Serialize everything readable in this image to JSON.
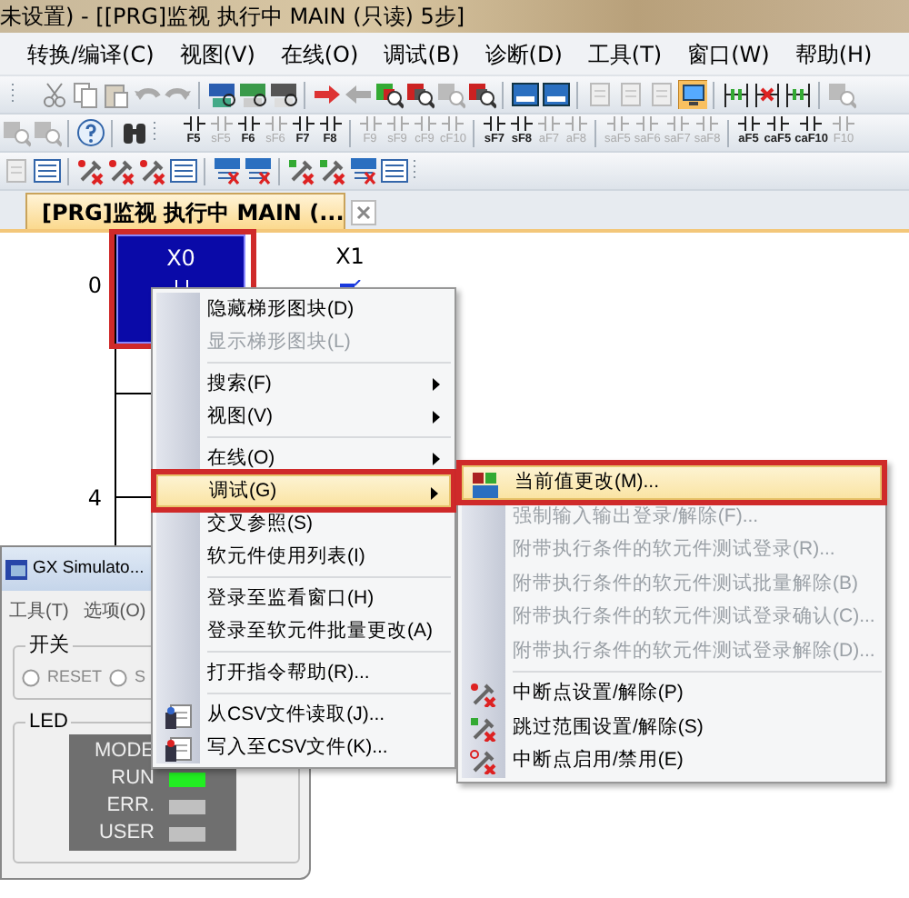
{
  "title_bar": {
    "title": "未设置) - [[PRG]监视 执行中 MAIN (只读) 5步]"
  },
  "menu_bar": [
    {
      "label": "转换/编译(C)"
    },
    {
      "label": "视图(V)"
    },
    {
      "label": "在线(O)"
    },
    {
      "label": "调试(B)"
    },
    {
      "label": "诊断(D)"
    },
    {
      "label": "工具(T)"
    },
    {
      "label": "窗口(W)"
    },
    {
      "label": "帮助(H)"
    }
  ],
  "toolbar_keys": [
    {
      "label": "F5",
      "disabled": false
    },
    {
      "label": "sF5",
      "disabled": true
    },
    {
      "label": "F6",
      "disabled": false
    },
    {
      "label": "sF6",
      "disabled": true
    },
    {
      "label": "F7",
      "disabled": false
    },
    {
      "label": "F8",
      "disabled": false
    },
    {
      "label": "F9",
      "disabled": true
    },
    {
      "label": "sF9",
      "disabled": true
    },
    {
      "label": "cF9",
      "disabled": true
    },
    {
      "label": "cF10",
      "disabled": true
    },
    {
      "label": "sF7",
      "disabled": false
    },
    {
      "label": "sF8",
      "disabled": false
    },
    {
      "label": "aF7",
      "disabled": true
    },
    {
      "label": "aF8",
      "disabled": true
    },
    {
      "label": "saF5",
      "disabled": true
    },
    {
      "label": "saF6",
      "disabled": true
    },
    {
      "label": "saF7",
      "disabled": true
    },
    {
      "label": "saF8",
      "disabled": true
    },
    {
      "label": "aF5",
      "disabled": false
    },
    {
      "label": "caF5",
      "disabled": false
    },
    {
      "label": "caF10",
      "disabled": false
    },
    {
      "label": "F10",
      "disabled": true
    }
  ],
  "tab": {
    "label": "[PRG]监视 执行中 MAIN (...",
    "selected": true
  },
  "ladder": {
    "steps": [
      {
        "label": "0"
      },
      {
        "label": "4"
      }
    ],
    "contacts": [
      {
        "label": "X0",
        "selected": true,
        "framed": true
      },
      {
        "label": "X1",
        "selected": false,
        "framed": false
      }
    ]
  },
  "context_menu": {
    "items": [
      {
        "kind": "item",
        "label": "隐藏梯形图块(D)",
        "disabled": false,
        "submenu": false,
        "selected": false,
        "framed": false,
        "has_icon": false
      },
      {
        "kind": "item",
        "label": "显示梯形图块(L)",
        "disabled": true,
        "submenu": false,
        "selected": false,
        "framed": false,
        "has_icon": false
      },
      {
        "kind": "separator"
      },
      {
        "kind": "item",
        "label": "搜索(F)",
        "disabled": false,
        "submenu": true,
        "selected": false,
        "framed": false,
        "has_icon": false
      },
      {
        "kind": "item",
        "label": "视图(V)",
        "disabled": false,
        "submenu": true,
        "selected": false,
        "framed": false,
        "has_icon": false
      },
      {
        "kind": "separator"
      },
      {
        "kind": "item",
        "label": "在线(O)",
        "disabled": false,
        "submenu": true,
        "selected": false,
        "framed": false,
        "has_icon": false
      },
      {
        "kind": "item",
        "label": "调试(G)",
        "disabled": false,
        "submenu": true,
        "selected": true,
        "framed": true,
        "has_icon": false
      },
      {
        "kind": "item",
        "label": "交叉参照(S)",
        "disabled": false,
        "submenu": false,
        "selected": false,
        "framed": false,
        "has_icon": false
      },
      {
        "kind": "item",
        "label": "软元件使用列表(I)",
        "disabled": false,
        "submenu": false,
        "selected": false,
        "framed": false,
        "has_icon": false
      },
      {
        "kind": "separator"
      },
      {
        "kind": "item",
        "label": "登录至监看窗口(H)",
        "disabled": false,
        "submenu": false,
        "selected": false,
        "framed": false,
        "has_icon": false
      },
      {
        "kind": "item",
        "label": "登录至软元件批量更改(A)",
        "disabled": false,
        "submenu": false,
        "selected": false,
        "framed": false,
        "has_icon": false
      },
      {
        "kind": "separator"
      },
      {
        "kind": "item",
        "label": "打开指令帮助(R)...",
        "disabled": false,
        "submenu": false,
        "selected": false,
        "framed": false,
        "has_icon": false
      },
      {
        "kind": "separator"
      },
      {
        "kind": "item",
        "label": "从CSV文件读取(J)...",
        "disabled": false,
        "submenu": false,
        "selected": false,
        "framed": false,
        "has_icon": true
      },
      {
        "kind": "item",
        "label": "写入至CSV文件(K)...",
        "disabled": false,
        "submenu": false,
        "selected": false,
        "framed": false,
        "has_icon": true
      }
    ]
  },
  "submenu": {
    "items": [
      {
        "kind": "item",
        "label": "当前值更改(M)...",
        "disabled": false,
        "selected": true,
        "framed": true,
        "has_icon": true
      },
      {
        "kind": "item",
        "label": "强制输入输出登录/解除(F)...",
        "disabled": true,
        "selected": false,
        "framed": false,
        "has_icon": false
      },
      {
        "kind": "item",
        "label": "附带执行条件的软元件测试登录(R)...",
        "disabled": true,
        "selected": false,
        "framed": false,
        "has_icon": false
      },
      {
        "kind": "item",
        "label": "附带执行条件的软元件测试批量解除(B)",
        "disabled": true,
        "selected": false,
        "framed": false,
        "has_icon": false
      },
      {
        "kind": "item",
        "label": "附带执行条件的软元件测试登录确认(C)...",
        "disabled": true,
        "selected": false,
        "framed": false,
        "has_icon": false
      },
      {
        "kind": "item",
        "label": "附带执行条件的软元件测试登录解除(D)...",
        "disabled": true,
        "selected": false,
        "framed": false,
        "has_icon": false
      },
      {
        "kind": "separator"
      },
      {
        "kind": "item",
        "label": "中断点设置/解除(P)",
        "disabled": false,
        "selected": false,
        "framed": false,
        "has_icon": true
      },
      {
        "kind": "item",
        "label": "跳过范围设置/解除(S)",
        "disabled": false,
        "selected": false,
        "framed": false,
        "has_icon": true
      },
      {
        "kind": "item",
        "label": "中断点启用/禁用(E)",
        "disabled": false,
        "selected": false,
        "framed": false,
        "has_icon": true
      }
    ]
  },
  "simulator": {
    "title": "GX Simulato...",
    "menu": [
      {
        "label": "工具(T)"
      },
      {
        "label": "选项(O)"
      }
    ],
    "switch_group": {
      "label": "开关",
      "options": [
        {
          "label": "RESET",
          "selected": false
        },
        {
          "label": "S",
          "selected": false
        }
      ]
    },
    "led_group": {
      "label": "LED",
      "leds": [
        {
          "label": "MODE"
        },
        {
          "label": "RUN",
          "on": true
        },
        {
          "label": "ERR.",
          "on": false
        },
        {
          "label": "USER",
          "on": false
        }
      ]
    }
  }
}
